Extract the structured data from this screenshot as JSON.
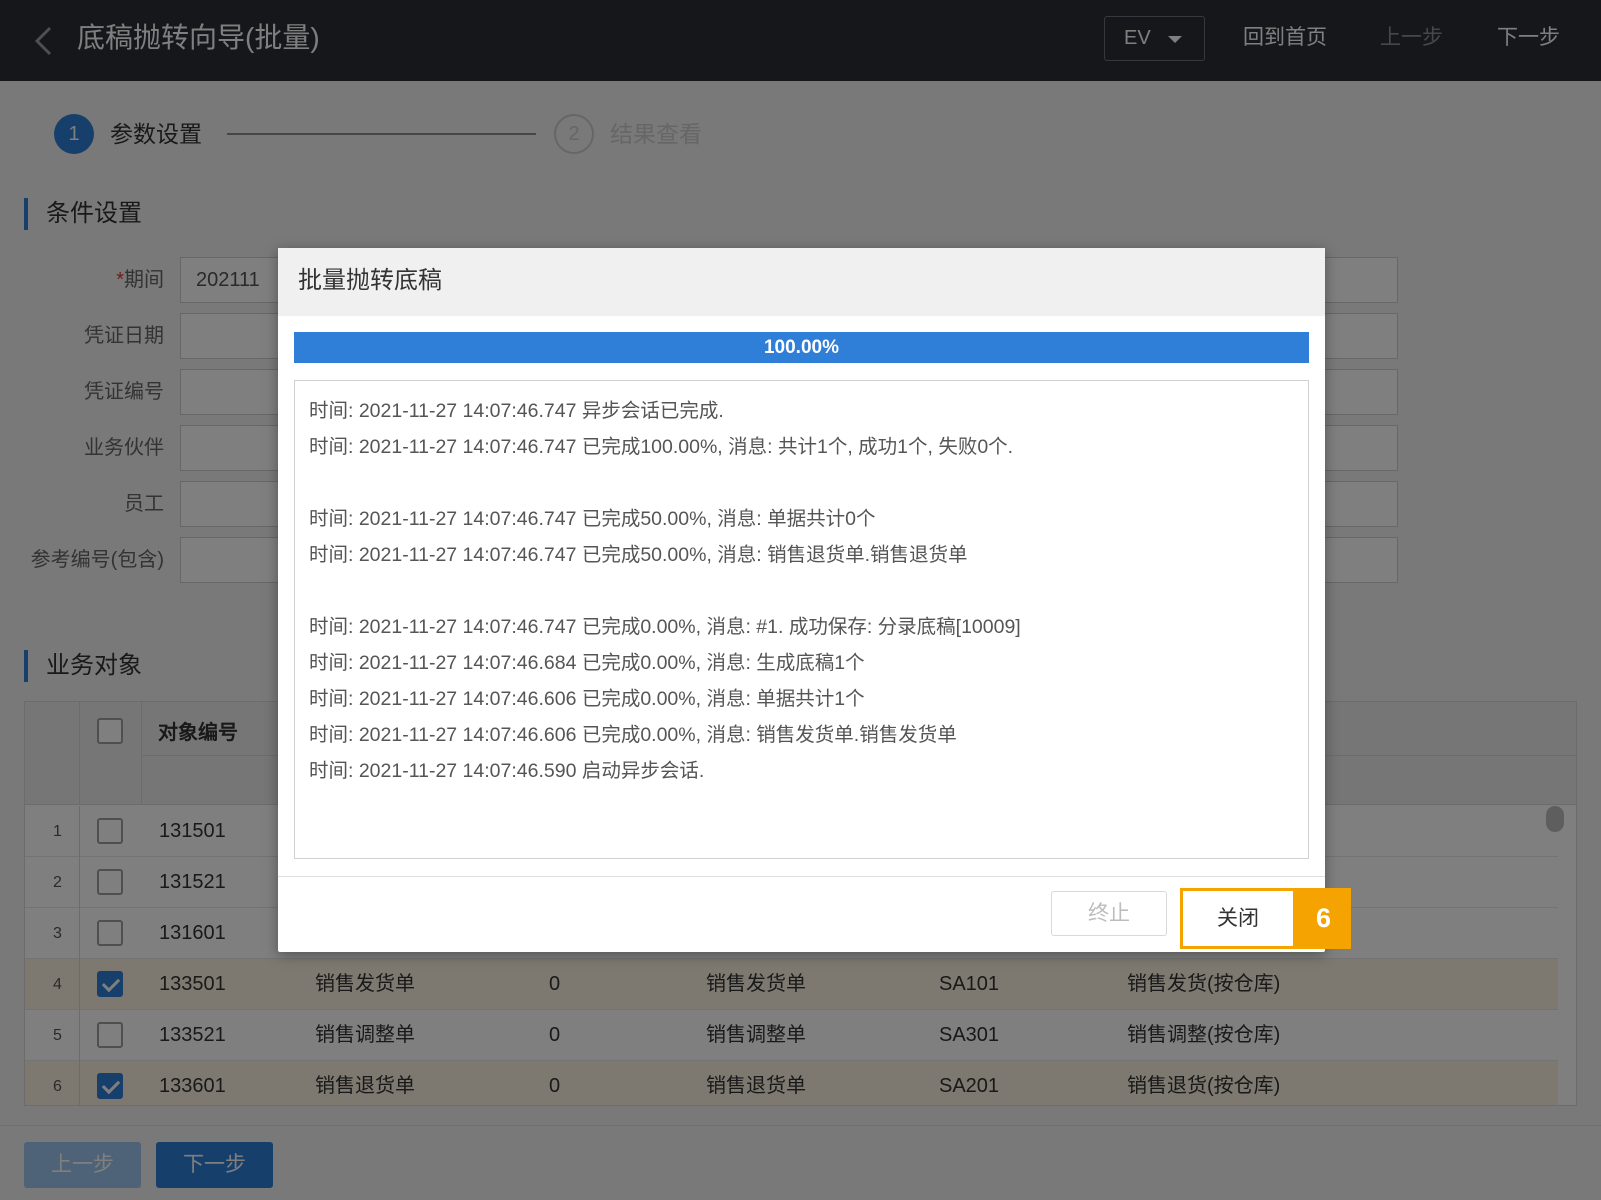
{
  "header": {
    "title": "底稿抛转向导(批量)",
    "ev_select": "EV",
    "home_link": "回到首页",
    "prev_link": "上一步",
    "next_link": "下一步"
  },
  "steps": [
    {
      "number": "1",
      "label": "参数设置"
    },
    {
      "number": "2",
      "label": "结果查看"
    }
  ],
  "conditions": {
    "section_title": "条件设置",
    "fields": [
      {
        "label": "期间",
        "required_mark": "*",
        "value": "202111"
      },
      {
        "label": "凭证日期",
        "value": ""
      },
      {
        "label": "凭证编号",
        "value": ""
      },
      {
        "label": "业务伙伴",
        "value": ""
      },
      {
        "label": "员工",
        "value": ""
      },
      {
        "label": "参考编号(包含)",
        "value": ""
      }
    ]
  },
  "objects": {
    "section_title": "业务对象",
    "column_header": "对象编号",
    "rows": [
      {
        "num": "1",
        "code": "131501",
        "checked": false,
        "name": "",
        "qty": "",
        "type": "",
        "sa": "",
        "desc": ""
      },
      {
        "num": "2",
        "code": "131521",
        "checked": false,
        "name": "",
        "qty": "",
        "type": "",
        "sa": "",
        "desc": ""
      },
      {
        "num": "3",
        "code": "131601",
        "checked": false,
        "name": "",
        "qty": "",
        "type": "",
        "sa": "",
        "desc": ""
      },
      {
        "num": "4",
        "code": "133501",
        "checked": true,
        "name": "销售发货单",
        "qty": "0",
        "type": "销售发货单",
        "sa": "SA101",
        "desc": "销售发货(按仓库)"
      },
      {
        "num": "5",
        "code": "133521",
        "checked": false,
        "name": "销售调整单",
        "qty": "0",
        "type": "销售调整单",
        "sa": "SA301",
        "desc": "销售调整(按仓库)"
      },
      {
        "num": "6",
        "code": "133601",
        "checked": true,
        "name": "销售退货单",
        "qty": "0",
        "type": "销售退货单",
        "sa": "SA201",
        "desc": "销售退货(按仓库)"
      }
    ]
  },
  "footer": {
    "prev_button": "上一步",
    "next_button": "下一步"
  },
  "dialog": {
    "title": "批量抛转底稿",
    "progress_value": 1.0,
    "progress_text": "100.00%",
    "log": [
      "时间: 2021-11-27 14:07:46.747 异步会话已完成.",
      "时间: 2021-11-27 14:07:46.747 已完成100.00%, 消息: 共计1个, 成功1个, 失败0个.",
      "",
      "时间: 2021-11-27 14:07:46.747 已完成50.00%, 消息: 单据共计0个",
      "时间: 2021-11-27 14:07:46.747 已完成50.00%, 消息: 销售退货单.销售退货单",
      "",
      "时间: 2021-11-27 14:07:46.747 已完成0.00%, 消息: #1. 成功保存: 分录底稿[10009]",
      "时间: 2021-11-27 14:07:46.684 已完成0.00%, 消息: 生成底稿1个",
      "时间: 2021-11-27 14:07:46.606 已完成0.00%, 消息: 单据共计1个",
      "时间: 2021-11-27 14:07:46.606 已完成0.00%, 消息: 销售发货单.销售发货单",
      "时间: 2021-11-27 14:07:46.590 启动异步会话."
    ],
    "stop_button": "终止",
    "close_button": "关闭",
    "step_badge": "6"
  },
  "colors": {
    "accent": "#2f7ed8",
    "highlight": "#f5a300",
    "header_bg": "#2a2f36"
  },
  "icons": {
    "back": "chevron-left-icon",
    "dropdown": "caret-down-icon",
    "checkbox": "check-icon"
  }
}
